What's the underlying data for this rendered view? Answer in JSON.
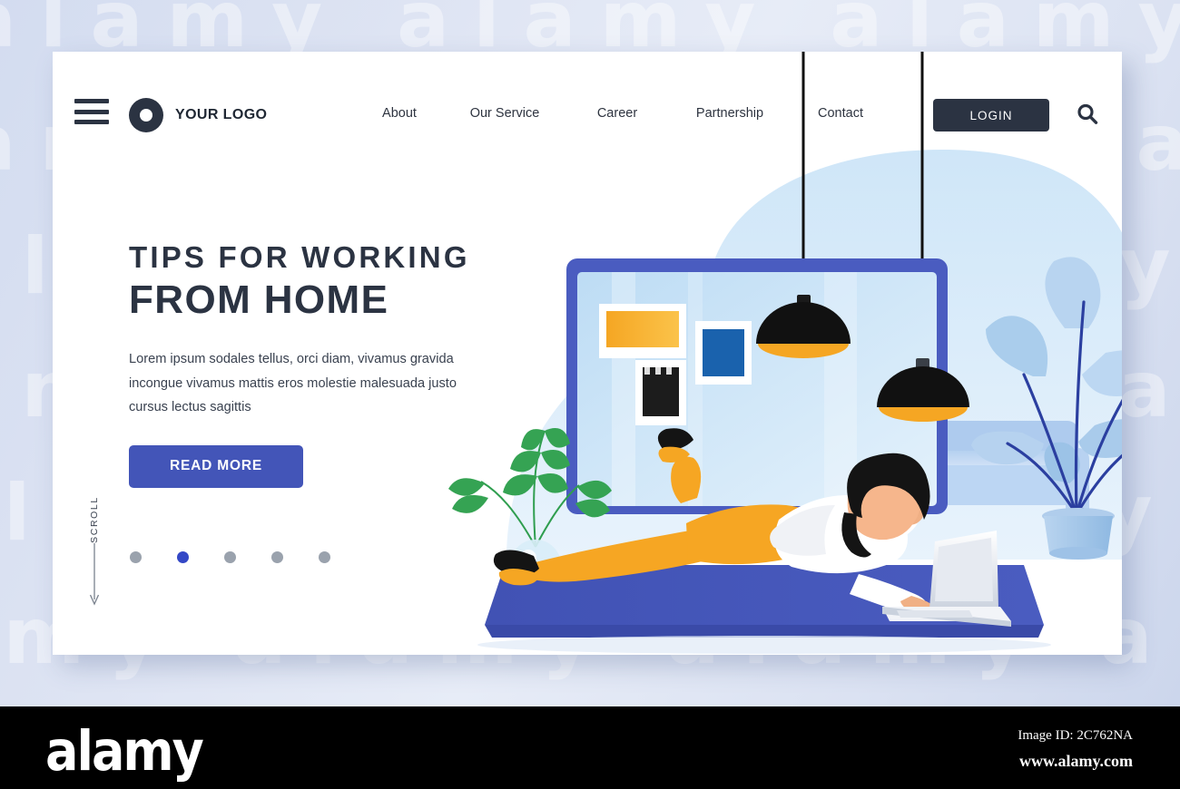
{
  "header": {
    "menu_icon": "hamburger-menu-icon",
    "brand": {
      "mark": "circle-ring-logo-icon",
      "text": "YOUR LOGO"
    },
    "nav": [
      {
        "label": "About"
      },
      {
        "label": "Our Service"
      },
      {
        "label": "Career"
      },
      {
        "label": "Partnership"
      },
      {
        "label": "Contact"
      }
    ],
    "login_label": "LOGIN",
    "search_icon": "search-icon"
  },
  "hero": {
    "headline_line1": "TIPS FOR WORKING",
    "headline_line2": "FROM HOME",
    "paragraph": "Lorem ipsum sodales tellus, orci diam, vivamus gravida incongue vivamus mattis eros molestie malesuada justo cursus lectus sagittis",
    "cta_label": "READ MORE",
    "scroll_label": "SCROLL",
    "dots": [
      {
        "active": false
      },
      {
        "active": true
      },
      {
        "active": false
      },
      {
        "active": false
      },
      {
        "active": false
      }
    ]
  },
  "illustration": {
    "name": "woman-working-from-home-illustration",
    "elements": [
      "laptop-screen-frame",
      "framed-picture-orange",
      "framed-picture-blue",
      "framed-picture-black",
      "pendant-lamp-left",
      "pendant-lamp-right",
      "sofa",
      "potted-monstera-plant",
      "fern-in-glass-vase",
      "blue-floor-mat",
      "woman-lying-down",
      "open-laptop"
    ]
  },
  "watermark": {
    "text": "alamy",
    "rows": [
      "alamy",
      "alamy",
      "alamy",
      "alamy",
      "alamy",
      "alamy",
      "alamy"
    ]
  },
  "footer": {
    "logo_text": "alamy",
    "image_id": "Image ID: 2C762NA",
    "url": "www.alamy.com"
  },
  "colors": {
    "page_bg": "#d7deef",
    "card_bg": "#ffffff",
    "ink": "#2b3342",
    "accent_button": "#4355b8",
    "dot_active": "#3448c6",
    "dot_inactive": "#9aa2ad",
    "lamp_inner": "#f5a623",
    "trousers": "#f6a623",
    "mat": "#4355b8",
    "screen": "#bcdcf5"
  }
}
